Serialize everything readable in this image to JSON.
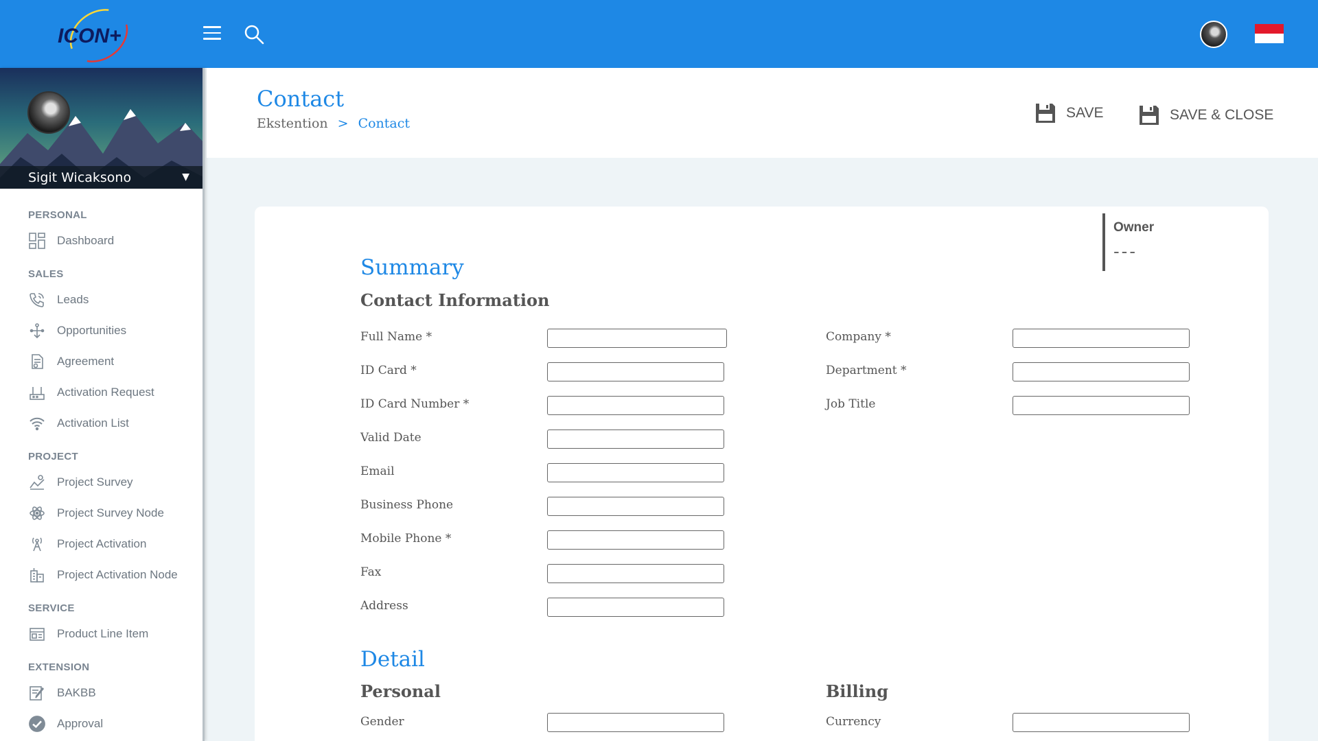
{
  "topbar": {
    "logo_text": "ICON+",
    "menu_icon": "hamburger-menu-icon",
    "search_icon": "search-icon",
    "language": "Indonesian flag"
  },
  "sidebar": {
    "user_name": "Sigit Wicaksono",
    "sections": [
      {
        "title": "PERSONAL",
        "items": [
          {
            "label": "Dashboard",
            "icon": "dashboard-icon"
          }
        ]
      },
      {
        "title": "SALES",
        "items": [
          {
            "label": "Leads",
            "icon": "phone-icon"
          },
          {
            "label": "Opportunities",
            "icon": "opportunities-icon"
          },
          {
            "label": "Agreement",
            "icon": "agreement-icon"
          },
          {
            "label": "Activation Request",
            "icon": "activation-request-icon"
          },
          {
            "label": "Activation List",
            "icon": "wifi-icon"
          }
        ]
      },
      {
        "title": "PROJECT",
        "items": [
          {
            "label": "Project Survey",
            "icon": "survey-icon"
          },
          {
            "label": "Project Survey Node",
            "icon": "network-node-icon"
          },
          {
            "label": "Project Activation",
            "icon": "antenna-icon"
          },
          {
            "label": "Project Activation Node",
            "icon": "building-icon"
          }
        ]
      },
      {
        "title": "SERVICE",
        "items": [
          {
            "label": "Product Line Item",
            "icon": "product-line-icon"
          }
        ]
      },
      {
        "title": "EXTENSION",
        "items": [
          {
            "label": "BAKBB",
            "icon": "document-edit-icon"
          },
          {
            "label": "Approval",
            "icon": "check-circle-icon"
          }
        ]
      }
    ]
  },
  "header": {
    "title": "Contact",
    "breadcrumb": [
      "Ekstention",
      ">",
      "Contact"
    ],
    "save_label": "SAVE",
    "save_close_label": "SAVE & CLOSE"
  },
  "form": {
    "owner_label": "Owner",
    "owner_value": "---",
    "summary_title": "Summary",
    "contact_info_title": "Contact Information",
    "left_fields": [
      {
        "label": "Full Name *",
        "value": ""
      },
      {
        "label": "ID Card *",
        "value": ""
      },
      {
        "label": "ID Card Number *",
        "value": ""
      },
      {
        "label": "Valid Date",
        "value": ""
      },
      {
        "label": "Email",
        "value": ""
      },
      {
        "label": "Business Phone",
        "value": ""
      },
      {
        "label": "Mobile Phone *",
        "value": ""
      },
      {
        "label": "Fax",
        "value": ""
      },
      {
        "label": "Address",
        "value": ""
      }
    ],
    "right_fields": [
      {
        "label": "Company *",
        "value": ""
      },
      {
        "label": "Department *",
        "value": ""
      },
      {
        "label": "Job Title",
        "value": ""
      }
    ],
    "detail_title": "Detail",
    "personal_title": "Personal",
    "billing_title": "Billing",
    "personal_fields": [
      {
        "label": "Gender",
        "value": ""
      }
    ],
    "billing_fields": [
      {
        "label": "Currency",
        "value": ""
      }
    ]
  },
  "colors": {
    "primary": "#1e88e5",
    "text": "#555555",
    "background": "#eef4f7"
  }
}
